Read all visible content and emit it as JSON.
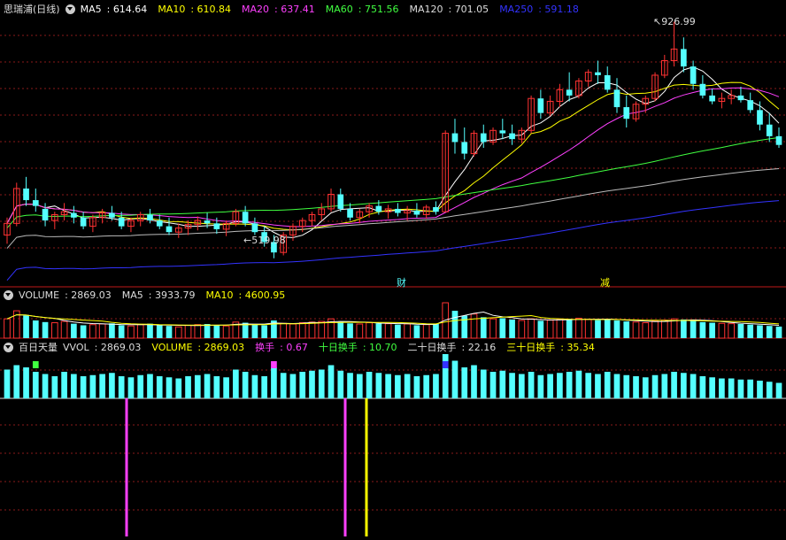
{
  "main": {
    "title": "思瑞浦(日线)",
    "indicators": [
      {
        "label": "MA5",
        "value": "614.64",
        "color": "#ffffff"
      },
      {
        "label": "MA10",
        "value": "610.84",
        "color": "#ffff00"
      },
      {
        "label": "MA20",
        "value": "637.41",
        "color": "#ff40ff"
      },
      {
        "label": "MA60",
        "value": "751.56",
        "color": "#40ff40"
      },
      {
        "label": "MA120",
        "value": "701.05",
        "color": "#dddddd"
      },
      {
        "label": "MA250",
        "value": "591.18",
        "color": "#3333ff"
      }
    ],
    "high_label": "926.99",
    "low_label": "519.98",
    "marker_cai": "财",
    "marker_jian": "减"
  },
  "volume": {
    "indicators": [
      {
        "label": "VOLUME",
        "value": "2869.03",
        "color": "#dddddd"
      },
      {
        "label": "MA5",
        "value": "3933.79",
        "color": "#dddddd"
      },
      {
        "label": "MA10",
        "value": "4600.95",
        "color": "#ffff00"
      }
    ]
  },
  "turnover": {
    "title": "百日天量",
    "indicators": [
      {
        "label": "VVOL",
        "value": "2869.03",
        "color": "#dddddd"
      },
      {
        "label": "VOLUME",
        "value": "2869.03",
        "color": "#ffff00"
      },
      {
        "label": "换手",
        "value": "0.67",
        "color": "#ff40ff"
      },
      {
        "label": "十日换手",
        "value": "10.70",
        "color": "#40ff40"
      },
      {
        "label": "二十日换手",
        "value": "22.16",
        "color": "#dddddd"
      },
      {
        "label": "三十日换手",
        "value": "35.34",
        "color": "#ffff00"
      }
    ]
  },
  "colors": {
    "up": "#ff3232",
    "down": "#54ffff",
    "grid": "#8a1a1a"
  },
  "chart_data": [
    {
      "type": "candlestick",
      "price_range": [
        480,
        940
      ],
      "max_price": 926.99,
      "min_price": 519.98,
      "ohlc": [
        [
          560,
          590,
          545,
          580
        ],
        [
          580,
          650,
          575,
          640
        ],
        [
          640,
          660,
          610,
          620
        ],
        [
          620,
          640,
          600,
          610
        ],
        [
          605,
          615,
          575,
          585
        ],
        [
          585,
          600,
          570,
          595
        ],
        [
          595,
          615,
          585,
          600
        ],
        [
          598,
          610,
          580,
          590
        ],
        [
          590,
          600,
          570,
          575
        ],
        [
          575,
          595,
          565,
          590
        ],
        [
          590,
          605,
          580,
          598
        ],
        [
          598,
          610,
          585,
          590
        ],
        [
          590,
          600,
          570,
          575
        ],
        [
          575,
          590,
          565,
          585
        ],
        [
          585,
          600,
          575,
          595
        ],
        [
          595,
          605,
          580,
          585
        ],
        [
          585,
          595,
          570,
          575
        ],
        [
          575,
          590,
          560,
          565
        ],
        [
          565,
          580,
          555,
          572
        ],
        [
          572,
          585,
          560,
          578
        ],
        [
          578,
          592,
          568,
          585
        ],
        [
          585,
          598,
          572,
          580
        ],
        [
          580,
          590,
          562,
          570
        ],
        [
          570,
          585,
          558,
          580
        ],
        [
          580,
          605,
          575,
          600
        ],
        [
          600,
          610,
          575,
          580
        ],
        [
          580,
          590,
          560,
          565
        ],
        [
          565,
          575,
          540,
          548
        ],
        [
          548,
          560,
          520,
          530
        ],
        [
          530,
          565,
          525,
          560
        ],
        [
          560,
          580,
          550,
          575
        ],
        [
          575,
          590,
          565,
          585
        ],
        [
          585,
          600,
          575,
          595
        ],
        [
          595,
          615,
          585,
          605
        ],
        [
          605,
          640,
          600,
          630
        ],
        [
          630,
          640,
          600,
          605
        ],
        [
          605,
          615,
          585,
          590
        ],
        [
          590,
          605,
          580,
          600
        ],
        [
          600,
          615,
          590,
          610
        ],
        [
          610,
          620,
          595,
          600
        ],
        [
          600,
          612,
          588,
          605
        ],
        [
          605,
          615,
          592,
          598
        ],
        [
          598,
          610,
          585,
          602
        ],
        [
          602,
          615,
          590,
          595
        ],
        [
          595,
          612,
          588,
          608
        ],
        [
          608,
          618,
          595,
          600
        ],
        [
          600,
          740,
          600,
          735
        ],
        [
          735,
          760,
          700,
          720
        ],
        [
          720,
          745,
          690,
          700
        ],
        [
          700,
          740,
          695,
          735
        ],
        [
          735,
          750,
          710,
          720
        ],
        [
          720,
          745,
          715,
          740
        ],
        [
          740,
          760,
          725,
          735
        ],
        [
          735,
          750,
          715,
          725
        ],
        [
          725,
          745,
          718,
          740
        ],
        [
          740,
          800,
          735,
          795
        ],
        [
          795,
          810,
          760,
          770
        ],
        [
          770,
          800,
          765,
          790
        ],
        [
          790,
          820,
          780,
          810
        ],
        [
          810,
          840,
          790,
          800
        ],
        [
          800,
          830,
          795,
          825
        ],
        [
          825,
          845,
          815,
          840
        ],
        [
          840,
          860,
          820,
          835
        ],
        [
          835,
          850,
          805,
          810
        ],
        [
          810,
          830,
          770,
          780
        ],
        [
          780,
          800,
          745,
          760
        ],
        [
          760,
          790,
          755,
          785
        ],
        [
          785,
          800,
          770,
          795
        ],
        [
          795,
          840,
          790,
          835
        ],
        [
          835,
          870,
          830,
          860
        ],
        [
          860,
          926.99,
          850,
          880
        ],
        [
          880,
          900,
          840,
          850
        ],
        [
          850,
          860,
          810,
          820
        ],
        [
          820,
          835,
          795,
          800
        ],
        [
          800,
          812,
          785,
          790
        ],
        [
          790,
          805,
          778,
          795
        ],
        [
          795,
          810,
          785,
          800
        ],
        [
          800,
          815,
          788,
          792
        ],
        [
          792,
          805,
          770,
          775
        ],
        [
          775,
          790,
          740,
          750
        ],
        [
          750,
          770,
          720,
          730
        ],
        [
          730,
          745,
          710,
          715
        ]
      ],
      "volume": [
        60,
        85,
        70,
        55,
        50,
        48,
        52,
        45,
        40,
        42,
        44,
        46,
        40,
        38,
        42,
        45,
        40,
        38,
        35,
        40,
        42,
        44,
        40,
        38,
        50,
        48,
        42,
        40,
        55,
        46,
        44,
        48,
        50,
        52,
        60,
        50,
        46,
        44,
        48,
        46,
        45,
        42,
        44,
        40,
        42,
        45,
        110,
        85,
        70,
        75,
        65,
        60,
        62,
        58,
        55,
        60,
        54,
        56,
        58,
        60,
        62,
        58,
        56,
        60,
        55,
        52,
        50,
        48,
        54,
        56,
        60,
        58,
        55,
        50,
        48,
        46,
        45,
        44,
        42,
        40,
        38,
        36
      ],
      "turnover_bars": [
        26,
        30,
        28,
        24,
        22,
        20,
        24,
        22,
        20,
        21,
        22,
        23,
        20,
        19,
        21,
        22,
        20,
        19,
        18,
        20,
        21,
        22,
        20,
        19,
        26,
        24,
        21,
        20,
        28,
        23,
        22,
        24,
        25,
        26,
        30,
        25,
        23,
        22,
        24,
        23,
        22,
        21,
        22,
        20,
        21,
        22,
        40,
        34,
        28,
        30,
        26,
        24,
        25,
        23,
        22,
        24,
        21,
        22,
        23,
        24,
        25,
        23,
        22,
        24,
        22,
        21,
        20,
        19,
        21,
        22,
        24,
        23,
        22,
        20,
        19,
        18,
        18,
        17,
        17,
        16,
        15,
        14
      ]
    }
  ]
}
